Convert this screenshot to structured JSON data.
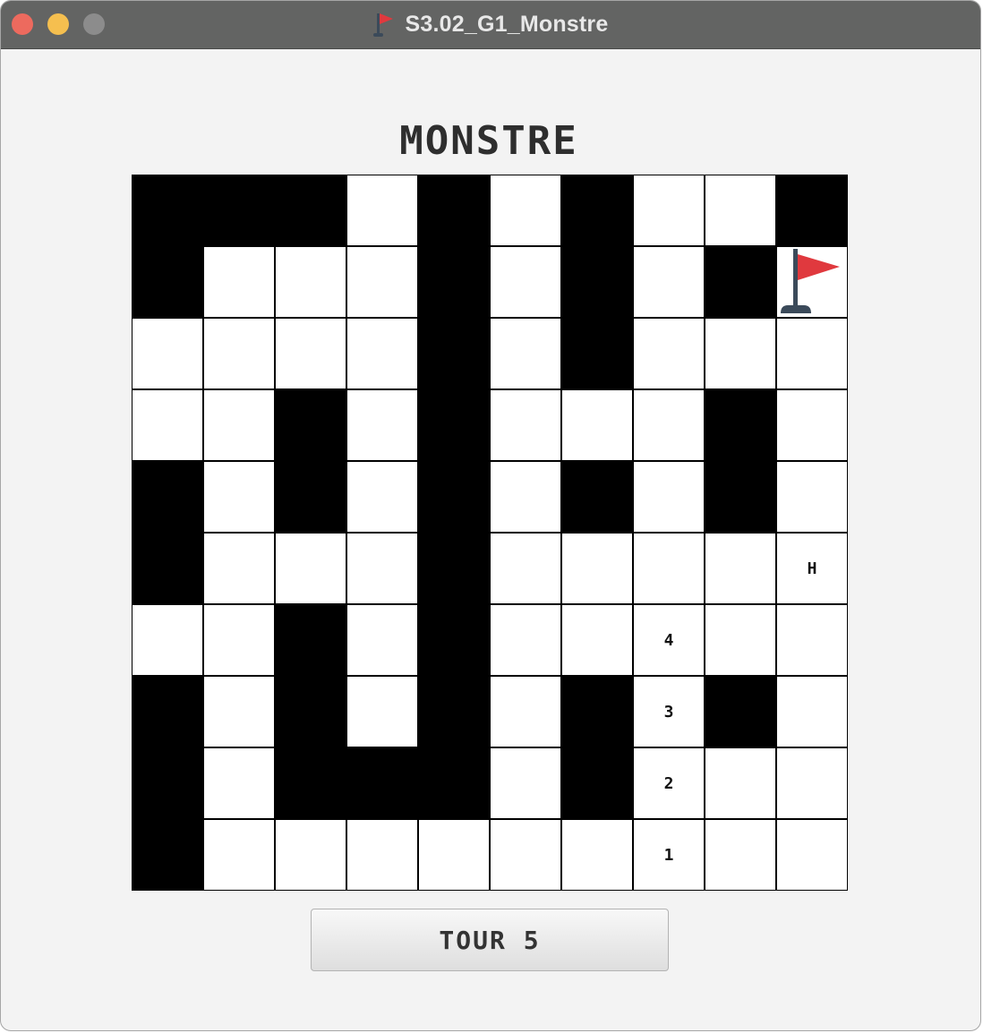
{
  "window": {
    "title": "S3.02_G1_Monstre",
    "title_icon": "flag-icon"
  },
  "game": {
    "title": "MONSTRE",
    "grid_size": 10,
    "walls": [
      [
        1,
        1,
        1,
        0,
        1,
        0,
        1,
        0,
        0,
        1
      ],
      [
        1,
        0,
        0,
        0,
        1,
        0,
        1,
        0,
        1,
        0
      ],
      [
        0,
        0,
        0,
        0,
        1,
        0,
        1,
        0,
        0,
        0
      ],
      [
        0,
        0,
        1,
        0,
        1,
        0,
        0,
        0,
        1,
        0
      ],
      [
        1,
        0,
        1,
        0,
        1,
        0,
        1,
        0,
        1,
        0
      ],
      [
        1,
        0,
        0,
        0,
        1,
        0,
        0,
        0,
        0,
        0
      ],
      [
        0,
        0,
        1,
        0,
        1,
        0,
        0,
        0,
        0,
        0
      ],
      [
        1,
        0,
        1,
        0,
        1,
        0,
        1,
        0,
        1,
        0
      ],
      [
        1,
        0,
        1,
        1,
        1,
        0,
        1,
        0,
        0,
        0
      ],
      [
        1,
        0,
        0,
        0,
        0,
        0,
        0,
        0,
        0,
        0
      ]
    ],
    "markers": [
      {
        "row": 1,
        "col": 9,
        "type": "flag",
        "icon": "red-flag-icon"
      },
      {
        "row": 5,
        "col": 9,
        "type": "text",
        "label": "H"
      },
      {
        "row": 6,
        "col": 7,
        "type": "text",
        "label": "4"
      },
      {
        "row": 7,
        "col": 7,
        "type": "text",
        "label": "3"
      },
      {
        "row": 8,
        "col": 7,
        "type": "text",
        "label": "2"
      },
      {
        "row": 9,
        "col": 7,
        "type": "text",
        "label": "1"
      }
    ],
    "colors": {
      "wall": "#000000",
      "floor": "#ffffff",
      "flag": "#e0393e",
      "flag_pole": "#3b4a5a"
    }
  },
  "controls": {
    "tour_label": "TOUR 5"
  }
}
